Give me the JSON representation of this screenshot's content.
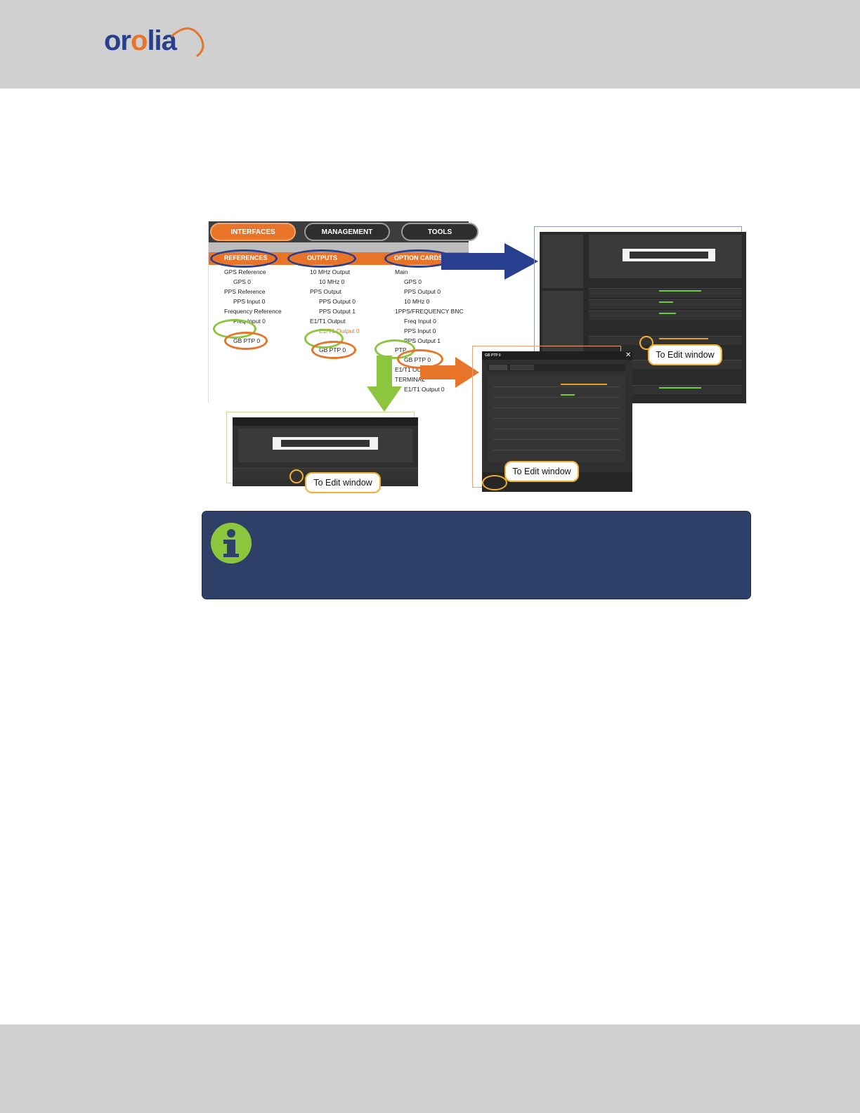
{
  "brand": {
    "logo_text": "orolia",
    "logo_color": "#283f8f",
    "accent": "#e8742a"
  },
  "menu": {
    "tabs": [
      "INTERFACES",
      "MANAGEMENT",
      "TOOLS"
    ],
    "categories": [
      "REFERENCES",
      "OUTPUTS",
      "OPTION CARDS"
    ],
    "references": [
      "GPS Reference",
      "GPS 0",
      "PPS Reference",
      "PPS Input 0",
      "Frequency Reference",
      "Freq Input 0",
      "GB PTP 0"
    ],
    "outputs": [
      "10 MHz Output",
      "10 MHz 0",
      "PPS Output",
      "PPS Output 0",
      "PPS Output 1",
      "E1/T1 Output",
      "E1/T1 Output 0",
      "GB PTP 0"
    ],
    "option_cards": [
      "Main",
      "GPS 0",
      "PPS Output 0",
      "10 MHz 0",
      "1PPS/FREQUENCY BNC",
      "Freq Input 0",
      "PPS Input 0",
      "PPS Output 1",
      "PTP",
      "GB PTP 0",
      "E1/T1 OUT 120 OHM",
      "TERMINAL",
      "E1/T1 Output 0"
    ]
  },
  "callouts": {
    "edit_1": "To Edit window",
    "edit_2": "To Edit window",
    "edit_3": "To Edit window"
  },
  "popup_right": {
    "title": "GB PTP 0",
    "close": "✕"
  },
  "colors": {
    "note_bg": "#2e4068",
    "info_icon": "#8cc63f",
    "header_footer": "#d0d0d0"
  },
  "icons": {
    "note": "info-icon"
  }
}
